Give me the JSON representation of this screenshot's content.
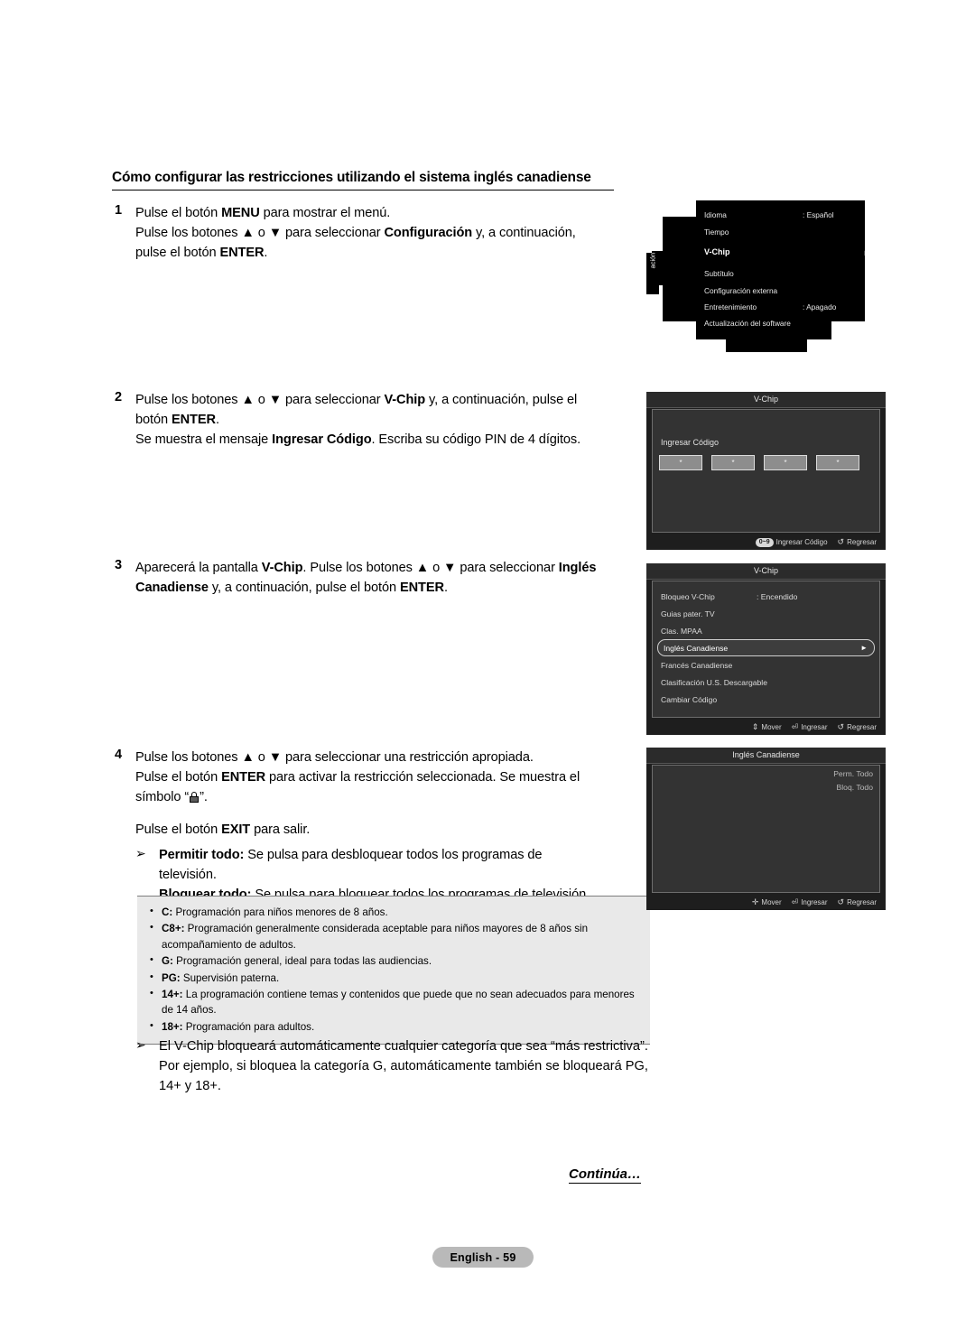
{
  "heading": "Cómo configurar las restricciones utilizando el sistema inglés canadiense",
  "steps": {
    "one": {
      "num": "1",
      "l1_a": "Pulse el botón ",
      "l1_b": "MENU",
      "l1_c": " para mostrar el menú.",
      "l2_a": "Pulse los botones ▲ o ▼ para seleccionar ",
      "l2_b": "Configuración",
      "l2_c": " y, a continuación,",
      "l3_a": "pulse el botón ",
      "l3_b": "ENTER",
      "l3_c": "."
    },
    "two": {
      "num": "2",
      "l1_a": "Pulse los botones ▲ o ▼ para seleccionar ",
      "l1_b": "V-Chip",
      "l1_c": " y, a continuación, pulse el",
      "l2_a": "botón ",
      "l2_b": "ENTER",
      "l2_c": ".",
      "l3_a": "Se muestra el mensaje ",
      "l3_b": "Ingresar Código",
      "l3_c": ". Escriba su código PIN de 4 dígitos."
    },
    "three": {
      "num": "3",
      "l1_a": "Aparecerá la pantalla ",
      "l1_b": "V-Chip",
      "l1_c": ". Pulse los botones ▲ o ▼ para seleccionar ",
      "l1_d": "Inglés",
      "l2_a": "Canadiense",
      "l2_b": " y, a continuación, pulse el botón ",
      "l2_c": "ENTER",
      "l2_d": "."
    },
    "four": {
      "num": "4",
      "l1": "Pulse los botones ▲ o ▼ para seleccionar una restricción apropiada.",
      "l2_a": "Pulse el botón ",
      "l2_b": "ENTER",
      "l2_c": " para activar la restricción seleccionada. Se muestra el",
      "l3_a": "símbolo “",
      "l3_b": "”.",
      "l4_a": "Pulse el botón ",
      "l4_b": "EXIT",
      "l4_c": " para salir.",
      "bullet_marker": "➢",
      "b1_a": "Permitir todo:",
      "b1_b": " Se pulsa para desbloquear todos los programas de",
      "b1_c": "televisión.",
      "b2_a": "Bloquear todo:",
      "b2_b": " Se pulsa para bloquear todos los programas de televisión."
    }
  },
  "ratings": [
    {
      "code": "C:",
      "text": " Programación para niños menores de 8 años."
    },
    {
      "code": "C8+:",
      "text": " Programación generalmente considerada aceptable para niños mayores de 8 años sin acompañamiento de adultos."
    },
    {
      "code": "G:",
      "text": " Programación general, ideal para todas las audiencias."
    },
    {
      "code": "PG:",
      "text": " Supervisión paterna."
    },
    {
      "code": "14+:",
      "text": " La programación contiene temas y contenidos que puede que no sean adecuados para menores de 14 años."
    },
    {
      "code": "18+:",
      "text": " Programación para adultos."
    }
  ],
  "note": {
    "marker": "➢",
    "l1": "El V-Chip bloqueará automáticamente cualquier categoría que sea “más",
    "l2": "restrictiva”. Por ejemplo, si bloquea la categoría G, automáticamente",
    "l3": "también se bloqueará PG, 14+ y 18+."
  },
  "footer": {
    "continua": "Continúa…",
    "page": "English - 59"
  },
  "osd1": {
    "side_tab": "ación",
    "rows": [
      {
        "label": "Idioma",
        "value": ": Español"
      },
      {
        "label": "Tiempo",
        "value": ""
      },
      {
        "label": "V-Chip",
        "value": ""
      },
      {
        "label": "Subtítulo",
        "value": ""
      },
      {
        "label": "Configuración externa",
        "value": ""
      },
      {
        "label": "Entretenimiento",
        "value": ": Apagado"
      },
      {
        "label": "Actualización del software",
        "value": ""
      }
    ],
    "chevron": "►"
  },
  "osd2": {
    "title": "V-Chip",
    "prompt": "Ingresar Código",
    "pin": [
      "*",
      "*",
      "*",
      "*"
    ],
    "hints": [
      {
        "key": "0~9",
        "label": "Ingresar Código"
      },
      {
        "key": "↺",
        "label": "Regresar"
      }
    ]
  },
  "osd3": {
    "title": "V-Chip",
    "items": [
      {
        "label": "Bloqueo V-Chip",
        "value": ": Encendido",
        "selected": false
      },
      {
        "label": "Guias pater. TV",
        "value": "",
        "selected": false
      },
      {
        "label": "Clas. MPAA",
        "value": "",
        "selected": false
      },
      {
        "label": "Inglés Canadiense",
        "value": "",
        "selected": true
      },
      {
        "label": "Francés Canadiense",
        "value": "",
        "selected": false
      },
      {
        "label": "Clasificación U.S. Descargable",
        "value": "",
        "selected": false
      },
      {
        "label": "Cambiar Código",
        "value": "",
        "selected": false
      }
    ],
    "chevron": "►",
    "hints": [
      {
        "key": "⇕",
        "label": "Mover"
      },
      {
        "key": "⏎",
        "label": "Ingresar"
      },
      {
        "key": "↺",
        "label": "Regresar"
      }
    ]
  },
  "osd4": {
    "title": "Inglés Canadiense",
    "options": [
      "Perm. Todo",
      "Bloq. Todo"
    ],
    "hints": [
      {
        "key": "✛",
        "label": "Mover"
      },
      {
        "key": "⏎",
        "label": "Ingresar"
      },
      {
        "key": "↺",
        "label": "Regresar"
      }
    ]
  }
}
